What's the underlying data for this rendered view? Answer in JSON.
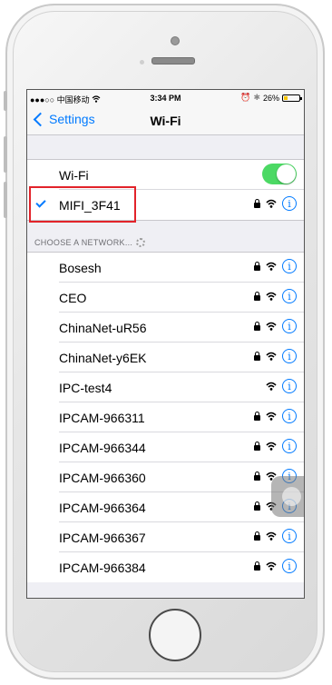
{
  "status_bar": {
    "carrier": "●●●○○ 中国移动 ",
    "time": "3:34 PM",
    "battery": "26%",
    "battery_level": 0.26
  },
  "nav": {
    "back_label": "Settings",
    "title": "Wi-Fi"
  },
  "wifi_toggle": {
    "label": "Wi-Fi",
    "on": true
  },
  "connected_network": {
    "name": "MIFI_3F41",
    "secured": true
  },
  "section": {
    "header": "CHOOSE A NETWORK..."
  },
  "networks": [
    {
      "name": "Bosesh",
      "secured": true
    },
    {
      "name": "CEO",
      "secured": true
    },
    {
      "name": "ChinaNet-uR56",
      "secured": true
    },
    {
      "name": "ChinaNet-y6EK",
      "secured": true
    },
    {
      "name": "IPC-test4",
      "secured": false
    },
    {
      "name": "IPCAM-966311",
      "secured": true
    },
    {
      "name": "IPCAM-966344",
      "secured": true
    },
    {
      "name": "IPCAM-966360",
      "secured": true
    },
    {
      "name": "IPCAM-966364",
      "secured": true
    },
    {
      "name": "IPCAM-966367",
      "secured": true
    },
    {
      "name": "IPCAM-966384",
      "secured": true
    }
  ],
  "icons": {
    "info": "i",
    "wifi": "wifi-icon",
    "lock": "lock-icon"
  },
  "colors": {
    "accent": "#007aff",
    "toggle_on": "#4cd964",
    "highlight_box": "#e2232a",
    "battery": "#f5c400"
  }
}
